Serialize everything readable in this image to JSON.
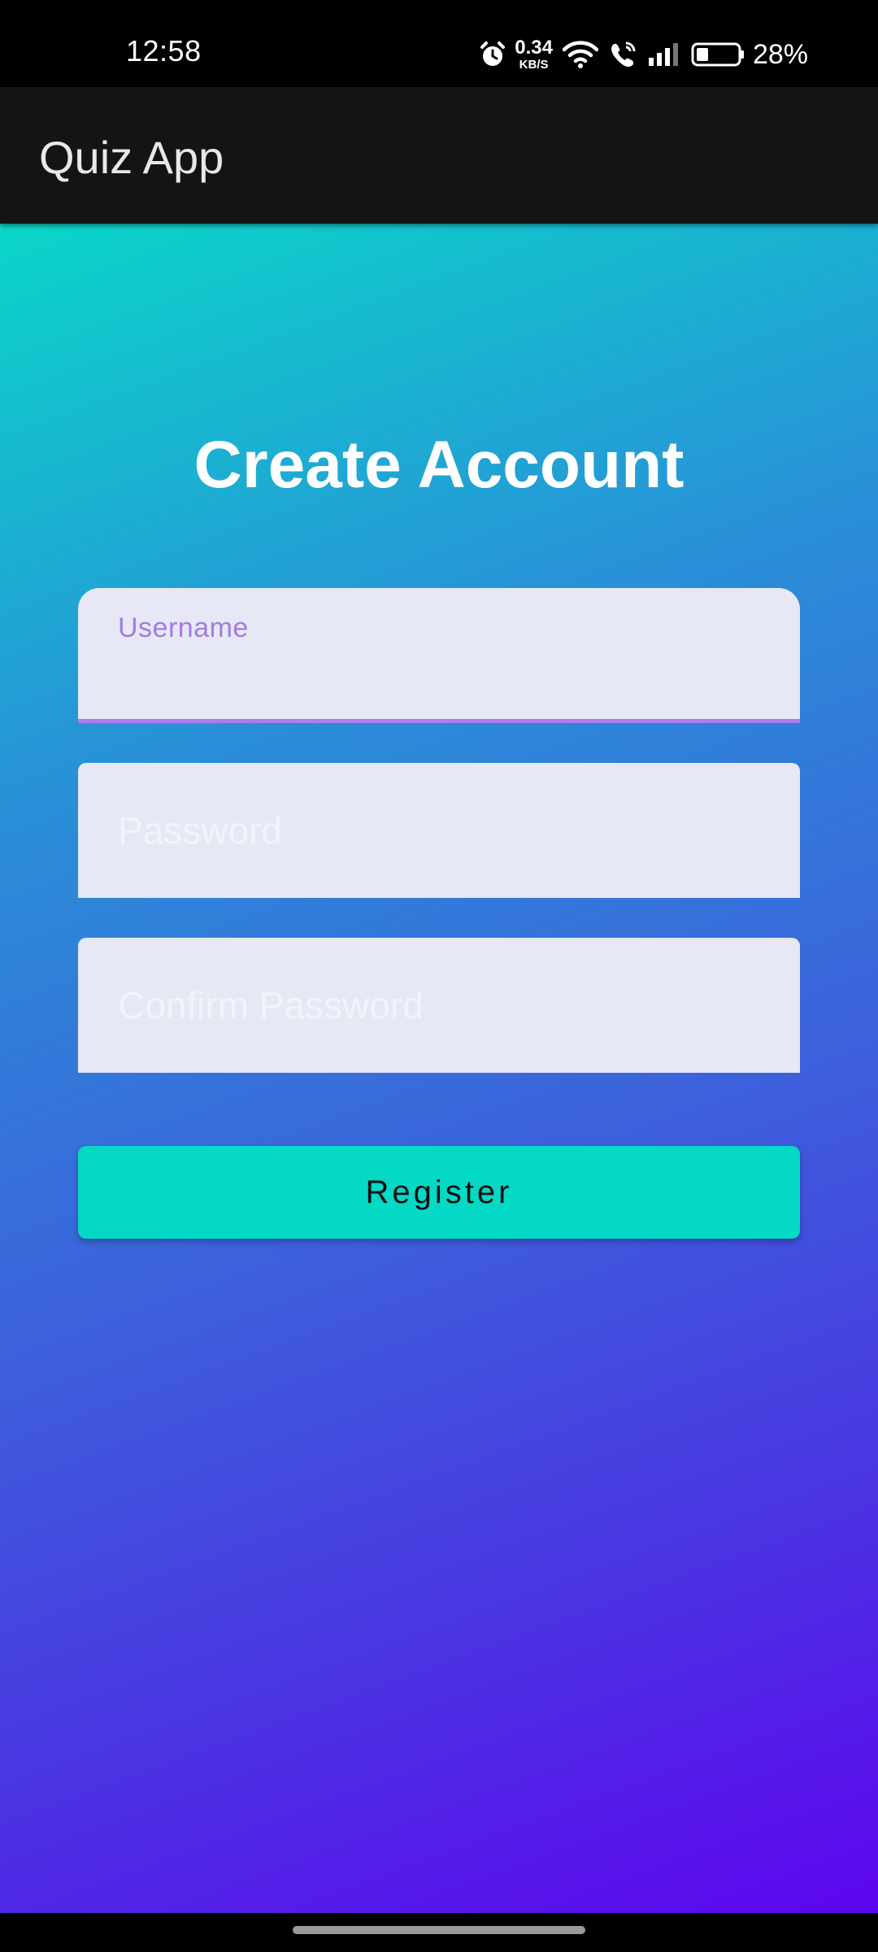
{
  "status_bar": {
    "time": "12:58",
    "net_speed_value": "0.34",
    "net_speed_unit": "KB/S",
    "battery_percent": "28%",
    "icons": [
      "alarm-icon",
      "wifi-icon",
      "wifi-calling-icon",
      "cellular-signal-icon",
      "battery-icon"
    ]
  },
  "app_bar": {
    "title": "Quiz App"
  },
  "form": {
    "heading": "Create Account",
    "username": {
      "label": "Username",
      "value": ""
    },
    "password": {
      "placeholder": "Password",
      "value": ""
    },
    "confirm_password": {
      "placeholder": "Confirm Password",
      "value": ""
    },
    "register_label": "Register"
  },
  "colors": {
    "gradient_top": "#0ad6c9",
    "gradient_bottom": "#5d05ef",
    "field_bg": "#e7e8f5",
    "focus_accent": "#b07cf0",
    "button": "#03d9c4",
    "app_bar": "#141414"
  }
}
